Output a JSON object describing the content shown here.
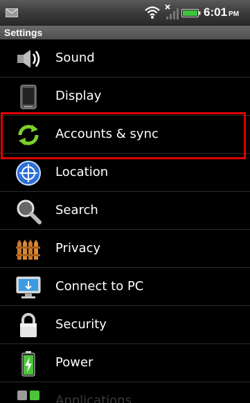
{
  "status_bar": {
    "time": "6:01",
    "ampm": "PM"
  },
  "header": {
    "title": "Settings"
  },
  "settings": {
    "items": [
      {
        "label": "Sound",
        "icon": "sound-icon"
      },
      {
        "label": "Display",
        "icon": "display-icon"
      },
      {
        "label": "Accounts & sync",
        "icon": "sync-icon"
      },
      {
        "label": "Location",
        "icon": "location-icon"
      },
      {
        "label": "Search",
        "icon": "search-icon"
      },
      {
        "label": "Privacy",
        "icon": "privacy-icon"
      },
      {
        "label": "Connect to PC",
        "icon": "connect-pc-icon"
      },
      {
        "label": "Security",
        "icon": "lock-icon"
      },
      {
        "label": "Power",
        "icon": "battery-power-icon"
      },
      {
        "label": "Applications",
        "icon": "applications-icon"
      }
    ]
  },
  "colors": {
    "highlight": "#e00000",
    "sync_green": "#7ccf2a"
  }
}
